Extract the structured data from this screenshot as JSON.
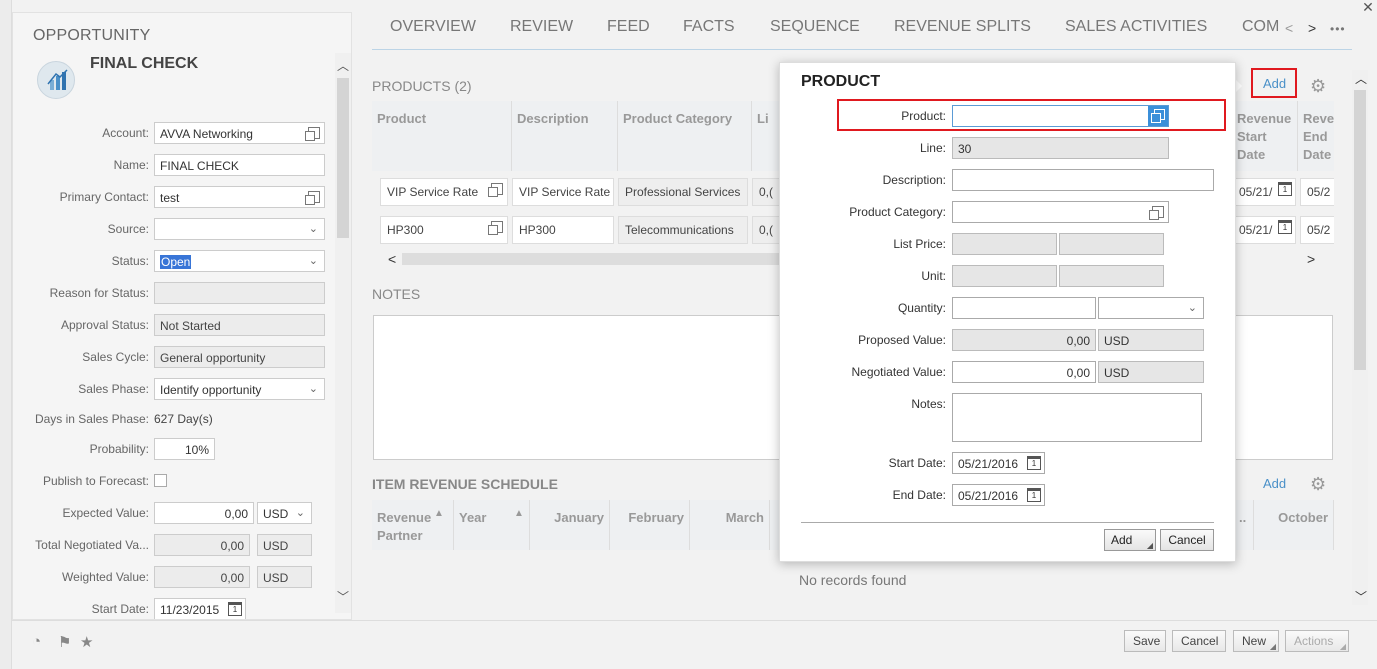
{
  "left": {
    "section_label": "OPPORTUNITY",
    "title": "FINAL CHECK",
    "fields": {
      "account": {
        "label": "Account:",
        "value": "AVVA Networking"
      },
      "name": {
        "label": "Name:",
        "value": "FINAL CHECK"
      },
      "primary_contact": {
        "label": "Primary Contact:",
        "value": "test"
      },
      "source": {
        "label": "Source:",
        "value": ""
      },
      "status": {
        "label": "Status:",
        "value": "Open"
      },
      "reason_for_status": {
        "label": "Reason for Status:",
        "value": ""
      },
      "approval_status": {
        "label": "Approval Status:",
        "value": "Not Started"
      },
      "sales_cycle": {
        "label": "Sales Cycle:",
        "value": "General opportunity"
      },
      "sales_phase": {
        "label": "Sales Phase:",
        "value": "Identify opportunity"
      },
      "days_in_sales_phase": {
        "label": "Days in Sales Phase:",
        "value": "627 Day(s)"
      },
      "probability": {
        "label": "Probability:",
        "value": "10%"
      },
      "publish_to_forecast": {
        "label": "Publish to Forecast:"
      },
      "expected_value": {
        "label": "Expected Value:",
        "value": "0,00",
        "currency": "USD"
      },
      "total_negotiated_value": {
        "label": "Total Negotiated Va...",
        "value": "0,00",
        "currency": "USD"
      },
      "weighted_value": {
        "label": "Weighted Value:",
        "value": "0,00",
        "currency": "USD"
      },
      "start_date": {
        "label": "Start Date:",
        "value": "11/23/2015"
      }
    }
  },
  "tabs": [
    "OVERVIEW",
    "REVIEW",
    "FEED",
    "FACTS",
    "SEQUENCE",
    "REVENUE SPLITS",
    "SALES ACTIVITIES",
    "COM"
  ],
  "products": {
    "title": "PRODUCTS (2)",
    "columns": [
      "Product",
      "Description",
      "Product Category",
      "Li",
      "Revenue Start Date",
      "Reve End Date"
    ],
    "rows": [
      {
        "product": "VIP Service Rate",
        "description": "VIP Service Rate",
        "category": "Professional Services",
        "list": "0,(",
        "start": "05/21/",
        "end": "05/2"
      },
      {
        "product": "HP300",
        "description": "HP300",
        "category": "Telecommunications",
        "list": "0,(",
        "start": "05/21/",
        "end": "05/2"
      }
    ],
    "add_label": "Add"
  },
  "notes": {
    "title": "NOTES"
  },
  "irs": {
    "title": "ITEM REVENUE SCHEDULE",
    "add_label": "Add",
    "columns": [
      "Revenue Partner",
      "Year",
      "January",
      "February",
      "March",
      "..",
      "October"
    ],
    "empty": "No records found"
  },
  "modal": {
    "title": "PRODUCT",
    "product": {
      "label": "Product:",
      "value": ""
    },
    "line": {
      "label": "Line:",
      "value": "30"
    },
    "description": {
      "label": "Description:",
      "value": ""
    },
    "product_category": {
      "label": "Product Category:",
      "value": ""
    },
    "list_price": {
      "label": "List Price:"
    },
    "unit": {
      "label": "Unit:"
    },
    "quantity": {
      "label": "Quantity:",
      "value": ""
    },
    "proposed_value": {
      "label": "Proposed Value:",
      "value": "0,00",
      "currency": "USD"
    },
    "negotiated_value": {
      "label": "Negotiated Value:",
      "value": "0,00",
      "currency": "USD"
    },
    "notes": {
      "label": "Notes:",
      "value": ""
    },
    "start_date": {
      "label": "Start Date:",
      "value": "05/21/2016"
    },
    "end_date": {
      "label": "End Date:",
      "value": "05/21/2016"
    },
    "add_button": "Add",
    "cancel_button": "Cancel"
  },
  "footer": {
    "save": "Save",
    "cancel": "Cancel",
    "new": "New",
    "actions": "Actions"
  },
  "icons": {
    "calendar_day": "1"
  },
  "colors": {
    "accent": "#4a90c8",
    "highlight": "#e0191f",
    "lookup_active": "#3b8fd9"
  }
}
